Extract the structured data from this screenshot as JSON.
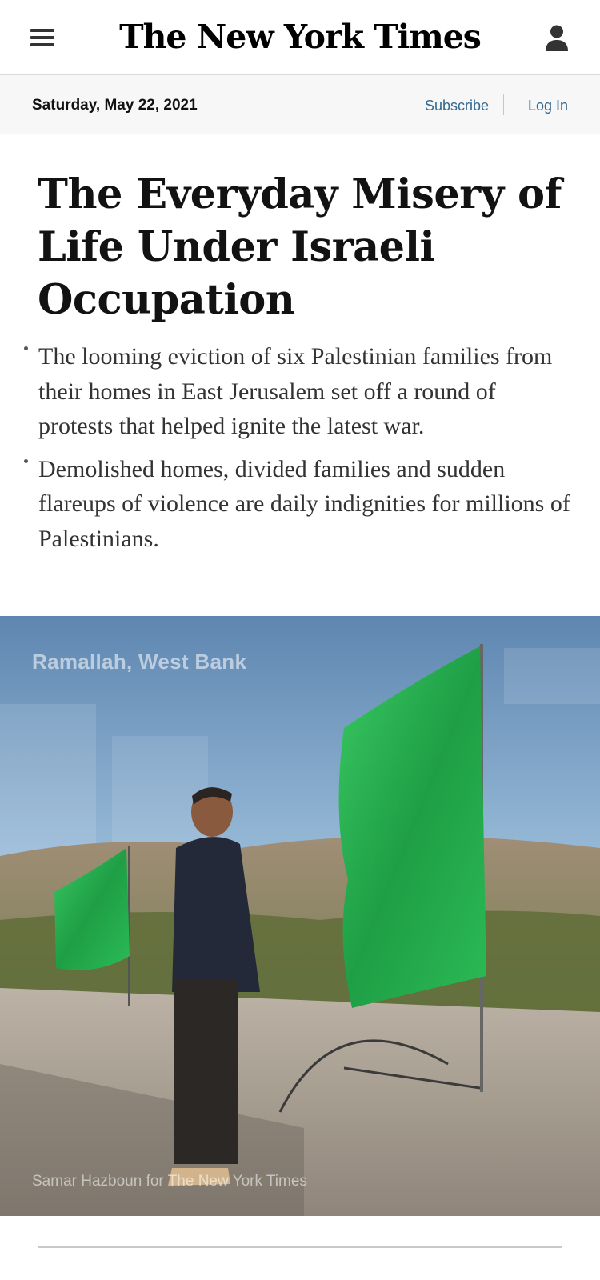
{
  "masthead": {
    "logo": "The New York Times",
    "menu_icon": "hamburger-menu-icon",
    "account_icon": "user-account-icon"
  },
  "datebar": {
    "date": "Saturday, May 22, 2021",
    "subscribe": "Subscribe",
    "login": "Log In"
  },
  "article": {
    "headline": "The Everyday Misery of Life Under Israeli Occupation",
    "summary": [
      "The looming eviction of six Palestinian families from their homes in East Jerusalem set off a round of protests that helped ignite the latest war.",
      "Demolished homes, divided families and sudden flareups of violence are daily indignities for millions of Palestinians."
    ],
    "image": {
      "dateline": "Ramallah, West Bank",
      "credit": "Samar Hazboun for The New York Times"
    }
  },
  "colors": {
    "link": "#326891",
    "flag_green": "#22a64a"
  }
}
